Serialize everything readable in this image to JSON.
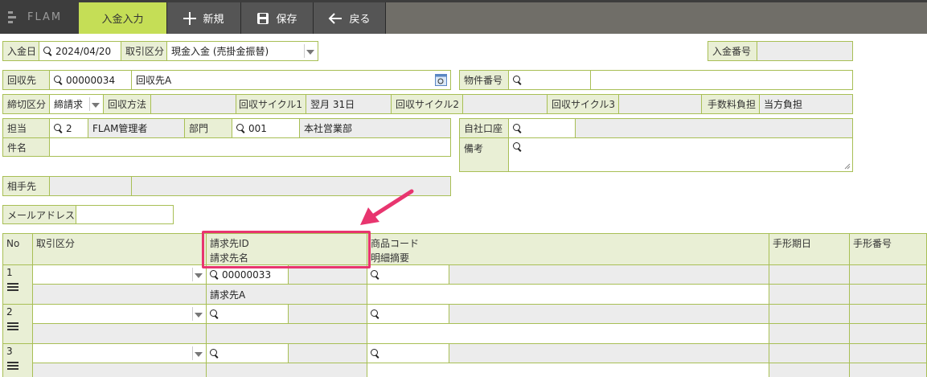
{
  "app": {
    "logo_text": "FLAM"
  },
  "toolbar": {
    "active_tab": "入金入力",
    "new_label": "新規",
    "save_label": "保存",
    "back_label": "戻る"
  },
  "form": {
    "date_label": "入金日",
    "date_value": "2024/04/20",
    "trade_type_label": "取引区分",
    "trade_type_value": "現金入金 (売掛金振替)",
    "receipt_no_label": "入金番号",
    "receipt_no_value": "",
    "collector_label": "回収先",
    "collector_code": "00000034",
    "collector_name": "回収先A",
    "property_no_label": "物件番号",
    "closing_label": "締切区分",
    "closing_value": "締請求",
    "method_label": "回収方法",
    "cycle1_label": "回収サイクル1",
    "cycle1_value": "翌月 31日",
    "cycle2_label": "回収サイクル2",
    "cycle3_label": "回収サイクル3",
    "fee_label": "手数料負担",
    "fee_value": "当方負担",
    "staff_label": "担当",
    "staff_code": "2",
    "staff_name": "FLAM管理者",
    "dept_label": "部門",
    "dept_code": "001",
    "dept_name": "本社営業部",
    "own_account_label": "自社口座",
    "subject_label": "件名",
    "note_label": "備考",
    "partner_label": "相手先",
    "email_label": "メールアドレス"
  },
  "grid": {
    "headers": {
      "no": "No",
      "trade_type": "取引区分",
      "billing_id": "請求先ID",
      "billing_name": "請求先名",
      "product_code": "商品コード",
      "detail": "明細摘要",
      "bill_date": "手形期日",
      "bill_no": "手形番号"
    },
    "rows": [
      {
        "no": "1",
        "billing_id": "00000033",
        "billing_name": "請求先A"
      },
      {
        "no": "2",
        "billing_id": "",
        "billing_name": ""
      },
      {
        "no": "3",
        "billing_id": "",
        "billing_name": ""
      }
    ]
  },
  "colors": {
    "accent": "#c5de56",
    "label_bg": "#e9efd5",
    "border": "#a8bf55",
    "highlight": "#e8356f"
  }
}
